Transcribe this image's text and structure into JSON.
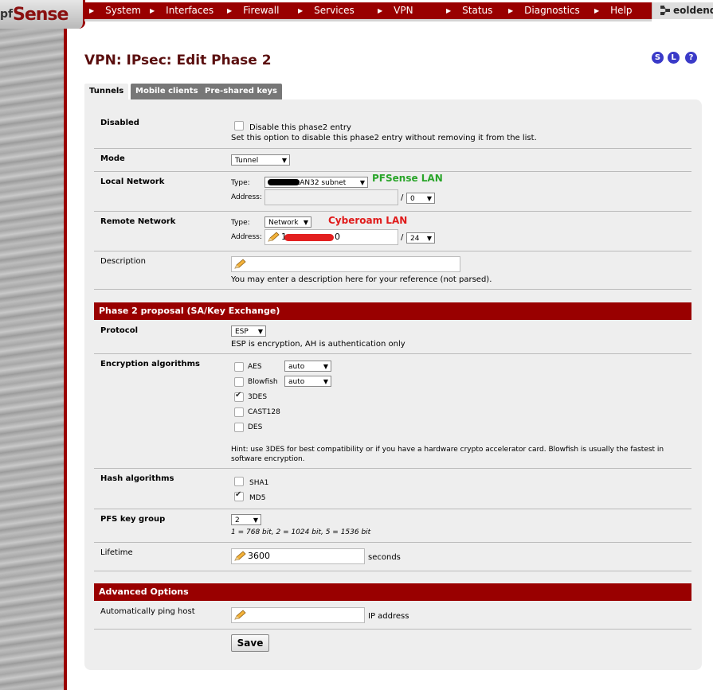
{
  "nav": {
    "logo": "Sense",
    "logo_prefix": "pf",
    "items": [
      "System",
      "Interfaces",
      "Firewall",
      "Services",
      "VPN",
      "Status",
      "Diagnostics",
      "Help"
    ],
    "host": "eoldend"
  },
  "page": {
    "title": "VPN: IPsec: Edit Phase 2",
    "help_icons": [
      "S",
      "L",
      "?"
    ]
  },
  "tabs": [
    {
      "label": "Tunnels",
      "active": true
    },
    {
      "label": "Mobile clients",
      "active": false
    },
    {
      "label": "Pre-shared keys",
      "active": false
    }
  ],
  "form": {
    "disabled": {
      "label": "Disabled",
      "checkbox_label": "Disable this phase2 entry",
      "hint": "Set this option to disable this phase2 entry without removing it from the list.",
      "checked": false
    },
    "mode": {
      "label": "Mode",
      "value": "Tunnel"
    },
    "local_network": {
      "label": "Local Network",
      "type_label": "Type:",
      "type_value": "LAN32 subnet",
      "address_label": "Address:",
      "slash": "/",
      "mask": "0",
      "annotation": "PFSense LAN"
    },
    "remote_network": {
      "label": "Remote Network",
      "type_label": "Type:",
      "type_value": "Network",
      "address_label": "Address:",
      "address_value_start": "1",
      "address_value_end": "0",
      "slash": "/",
      "mask": "24",
      "annotation": "Cyberoam LAN"
    },
    "description": {
      "label": "Description",
      "hint": "You may enter a description here for your reference (not parsed)."
    }
  },
  "phase2": {
    "section_title": "Phase 2 proposal (SA/Key Exchange)",
    "protocol": {
      "label": "Protocol",
      "value": "ESP",
      "hint": "ESP is encryption, AH is authentication only"
    },
    "encryption": {
      "label": "Encryption algorithms",
      "items": [
        {
          "name": "AES",
          "checked": false,
          "select": "auto"
        },
        {
          "name": "Blowfish",
          "checked": false,
          "select": "auto"
        },
        {
          "name": "3DES",
          "checked": true
        },
        {
          "name": "CAST128",
          "checked": false
        },
        {
          "name": "DES",
          "checked": false
        }
      ],
      "hint_line1": "Hint: use 3DES for best compatibility or if you have a hardware crypto accelerator card. Blowfish is usually the fastest in",
      "hint_line2": "software encryption."
    },
    "hash": {
      "label": "Hash algorithms",
      "items": [
        {
          "name": "SHA1",
          "checked": false
        },
        {
          "name": "MD5",
          "checked": true
        }
      ]
    },
    "pfs": {
      "label": "PFS key group",
      "value": "2",
      "hint": "1 = 768 bit, 2 = 1024 bit, 5 = 1536 bit"
    },
    "lifetime": {
      "label": "Lifetime",
      "value": "3600",
      "unit": "seconds"
    }
  },
  "advanced": {
    "section_title": "Advanced Options",
    "ping": {
      "label": "Automatically ping host",
      "unit": "IP address"
    },
    "save_label": "Save"
  },
  "colors": {
    "brand": "#990000",
    "annot_green": "#2aa52a",
    "annot_red": "#e01b1b"
  }
}
